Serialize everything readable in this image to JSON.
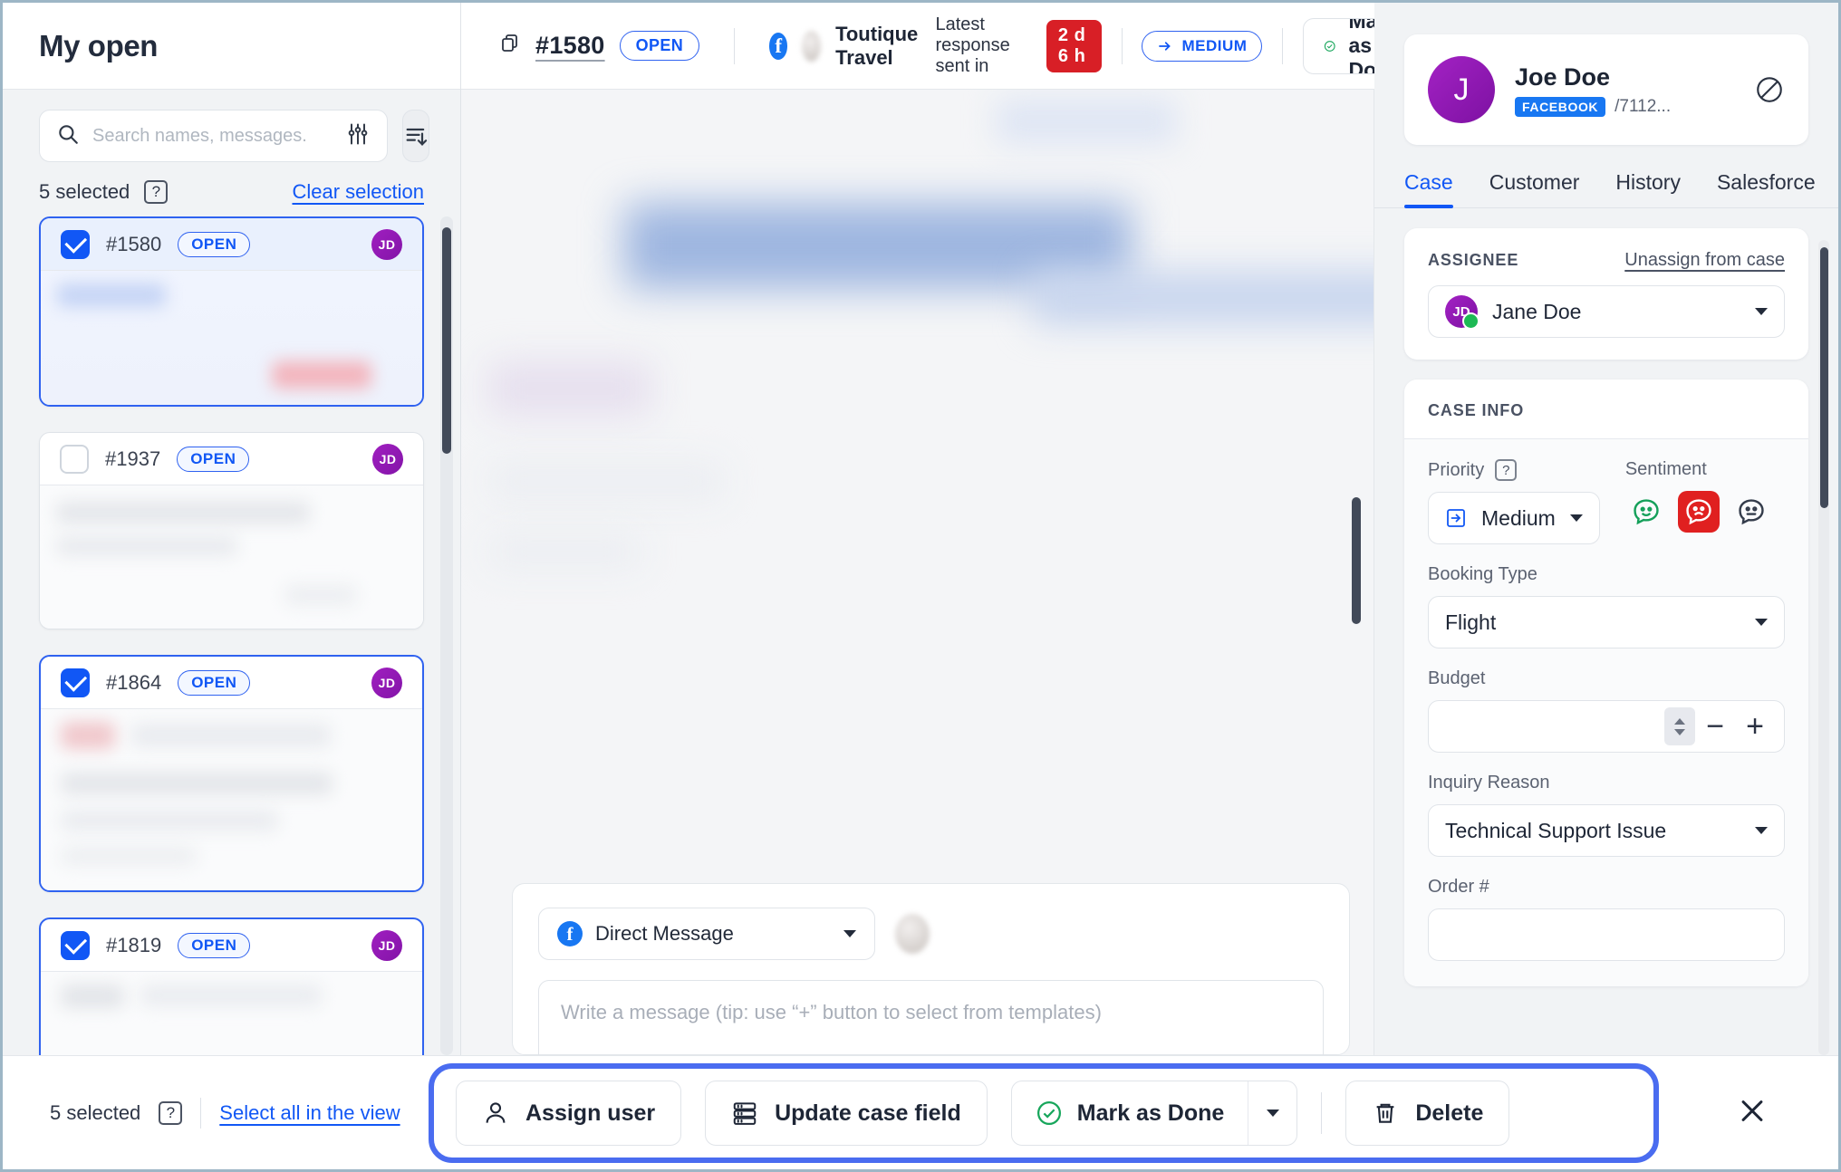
{
  "sidebar": {
    "title": "My open",
    "search": {
      "placeholder": "Search names, messages.",
      "value": ""
    },
    "filter_icon": "sliders-icon",
    "sort_icon": "sort-descending-icon",
    "selection": {
      "count_label": "5 selected",
      "help": "?",
      "clear_label": "Clear selection"
    },
    "cases": [
      {
        "id": "#1580",
        "status": "OPEN",
        "avatar": "JD",
        "selected": true,
        "active": true
      },
      {
        "id": "#1937",
        "status": "OPEN",
        "avatar": "JD",
        "selected": false,
        "active": false
      },
      {
        "id": "#1864",
        "status": "OPEN",
        "avatar": "JD",
        "selected": true,
        "active": false
      },
      {
        "id": "#1819",
        "status": "OPEN",
        "avatar": "JD",
        "selected": true,
        "active": false
      }
    ]
  },
  "main_header": {
    "copy_icon": "copy-icon",
    "case_number": "#1580",
    "status": "OPEN",
    "channel_icon": "facebook-icon",
    "org_name": "Toutique Travel",
    "response_label": "Latest response sent in",
    "sla_badge": "2 d 6 h",
    "priority_chip": "MEDIUM",
    "done_label": "Mark as Done"
  },
  "composer": {
    "channel_icon": "facebook-icon",
    "channel_label": "Direct Message",
    "message_placeholder": "Write a message (tip: use “+” button to select from templates)"
  },
  "right_panel": {
    "customer": {
      "avatar_initial": "J",
      "name": "Joe Doe",
      "network_tag": "FACEBOOK",
      "handle": "/7112...",
      "block_icon": "block-icon"
    },
    "tabs": [
      {
        "label": "Case",
        "active": true
      },
      {
        "label": "Customer",
        "active": false
      },
      {
        "label": "History",
        "active": false
      },
      {
        "label": "Salesforce",
        "active": false
      }
    ],
    "assignee": {
      "label": "ASSIGNEE",
      "unassign_label": "Unassign from case",
      "avatar": "JD",
      "value": "Jane Doe"
    },
    "case_info": {
      "label": "CASE INFO",
      "priority_label": "Priority",
      "priority_help": "?",
      "priority_value": "Medium",
      "sentiment_label": "Sentiment",
      "sentiment_selected": "negative",
      "booking_type_label": "Booking Type",
      "booking_type_value": "Flight",
      "budget_label": "Budget",
      "budget_value": "",
      "inquiry_reason_label": "Inquiry Reason",
      "inquiry_reason_value": "Technical Support Issue",
      "order_label": "Order #",
      "order_value": ""
    }
  },
  "bottom_bar": {
    "count_label": "5 selected",
    "help": "?",
    "select_all_label": "Select all in the view",
    "actions": [
      {
        "label": "Assign user",
        "icon": "user-icon"
      },
      {
        "label": "Update case field",
        "icon": "list-fields-icon"
      },
      {
        "label": "Mark as Done",
        "icon": "check-circle-icon"
      },
      {
        "label": "Delete",
        "icon": "trash-icon"
      }
    ],
    "close_icon": "close-icon"
  },
  "colors": {
    "accent_blue": "#1157f5",
    "highlight_blue": "#4a6cf0",
    "danger_red": "#d81f26",
    "sentiment_red": "#e02020",
    "purple_avatar": "#8314a8",
    "facebook_blue": "#1877f2",
    "green": "#1db954"
  }
}
